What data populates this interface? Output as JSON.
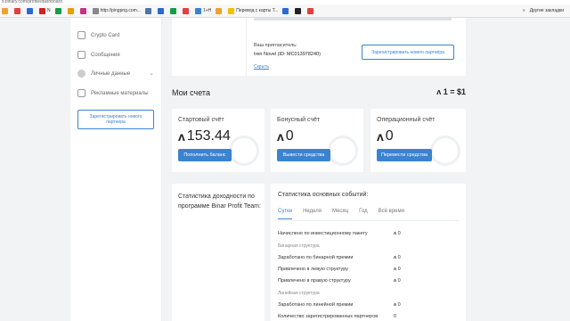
{
  "browser": {
    "url": "s.binary.com/profile/dashboard",
    "bookmarks": [
      {
        "label": "",
        "color": "#f0a030"
      },
      {
        "label": "",
        "color": "#e04040"
      },
      {
        "label": "",
        "color": "#2a6bd1"
      },
      {
        "label": "N",
        "color": "#cc2222"
      },
      {
        "label": "",
        "color": "#1a9a4a"
      },
      {
        "label": "",
        "color": "#e3a000"
      },
      {
        "label": "",
        "color": "#c13584"
      },
      {
        "label": "http://pingpng.com...",
        "color": "#888888"
      },
      {
        "label": "",
        "color": "#4a76a8"
      },
      {
        "label": "",
        "color": "#2a6bd1"
      },
      {
        "label": "",
        "color": "#1a9a4a"
      },
      {
        "label": "",
        "color": "#e04040"
      },
      {
        "label": "1+H",
        "color": "#3a83d1"
      },
      {
        "label": "",
        "color": "#f0a030"
      },
      {
        "label": "Перевод с карты T...",
        "color": "#f0c000"
      },
      {
        "label": "",
        "color": "#2a6bd1"
      },
      {
        "label": "",
        "color": "#222222"
      },
      {
        "label": "",
        "color": "#e04040"
      }
    ],
    "more": "»",
    "other_bookmarks": "Другие закладки"
  },
  "sidebar": {
    "items": [
      {
        "label": "Crypto Card",
        "icon": "card-icon"
      },
      {
        "label": "Сообщения",
        "icon": "message-icon"
      },
      {
        "label": "Личные данные",
        "icon": "user-icon"
      },
      {
        "label": "Рекламные материалы",
        "icon": "media-icon"
      }
    ],
    "register_button": "Зарегистрировать нового партнера"
  },
  "referral": {
    "label": "Ваш пригласитель:",
    "value": "Iren Novel (ID: MC013978240)",
    "hide_link": "Скрыть",
    "register_button": "Зарегистрировать нового партнёра"
  },
  "accounts": {
    "title": "Мои счета",
    "rate": "1 = $1",
    "currency_logo": "ʌ",
    "cards": [
      {
        "title": "Стартовый счёт",
        "value": "153.44",
        "button": "Пополнить баланс"
      },
      {
        "title": "Бонусный счёт",
        "value": "0",
        "button": "Вывести средства"
      },
      {
        "title": "Операционный счёт",
        "value": "0",
        "button": "Перевести средства"
      }
    ]
  },
  "stats_left": {
    "title": "Статистика доходности по программе Binar Profit Team:"
  },
  "stats_right": {
    "title": "Статистика основных событий:",
    "tabs": [
      "Сутки",
      "Неделя",
      "Месяц",
      "Год",
      "Всё время"
    ],
    "active_tab": "Сутки",
    "rows": [
      {
        "label": "Начислено по инвестиционному пакету",
        "value": "0"
      },
      {
        "label": "Заработано по бинарной премии",
        "value": "0"
      },
      {
        "label": "Привлечено в левую структуру",
        "value": "0"
      },
      {
        "label": "Привлечено в правую структуру",
        "value": "0"
      },
      {
        "label": "Заработано по линейной премии",
        "value": "0"
      },
      {
        "label": "Количество зарегистрированных партнеров",
        "value": "0"
      }
    ],
    "sections": [
      "Бинарная структура",
      "Линейная структура"
    ]
  },
  "colors": {
    "accent": "#3a83d1",
    "background": "#f1f3f5",
    "card": "#ffffff"
  }
}
